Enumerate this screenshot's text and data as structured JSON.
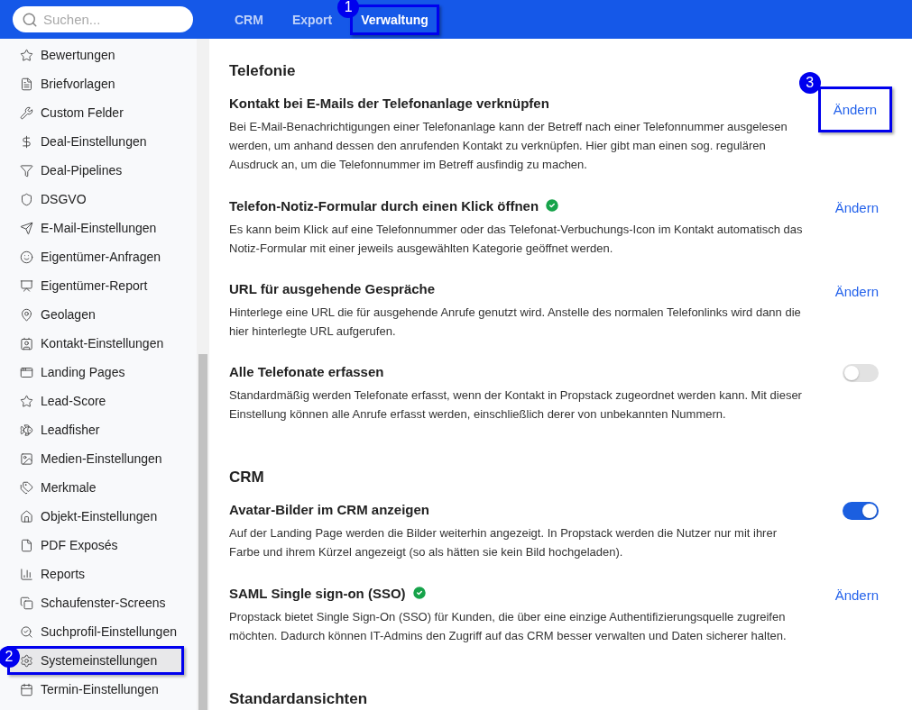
{
  "search": {
    "placeholder": "Suchen..."
  },
  "nav_tabs": [
    {
      "label": "CRM",
      "selected": false
    },
    {
      "label": "Export",
      "selected": false
    },
    {
      "label": "Verwaltung",
      "selected": true,
      "annotation": "1"
    }
  ],
  "sidebar": {
    "items": [
      {
        "label": "Bewertungen",
        "selected": false
      },
      {
        "label": "Briefvorlagen",
        "selected": false
      },
      {
        "label": "Custom Felder",
        "selected": false
      },
      {
        "label": "Deal-Einstellungen",
        "selected": false
      },
      {
        "label": "Deal-Pipelines",
        "selected": false
      },
      {
        "label": "DSGVO",
        "selected": false
      },
      {
        "label": "E-Mail-Einstellungen",
        "selected": false
      },
      {
        "label": "Eigentümer-Anfragen",
        "selected": false
      },
      {
        "label": "Eigentümer-Report",
        "selected": false
      },
      {
        "label": "Geolagen",
        "selected": false
      },
      {
        "label": "Kontakt-Einstellungen",
        "selected": false
      },
      {
        "label": "Landing Pages",
        "selected": false
      },
      {
        "label": "Lead-Score",
        "selected": false
      },
      {
        "label": "Leadfisher",
        "selected": false
      },
      {
        "label": "Medien-Einstellungen",
        "selected": false
      },
      {
        "label": "Merkmale",
        "selected": false
      },
      {
        "label": "Objekt-Einstellungen",
        "selected": false
      },
      {
        "label": "PDF Exposés",
        "selected": false
      },
      {
        "label": "Reports",
        "selected": false
      },
      {
        "label": "Schaufenster-Screens",
        "selected": false
      },
      {
        "label": "Suchprofil-Einstellungen",
        "selected": false
      },
      {
        "label": "Systemeinstellungen",
        "selected": true,
        "annotation": "2"
      },
      {
        "label": "Termin-Einstellungen",
        "selected": false
      }
    ]
  },
  "sections": [
    {
      "title": "Telefonie",
      "settings": [
        {
          "kind": "action",
          "title": "Kontakt bei E-Mails der Telefonanlage verknüpfen",
          "verified": false,
          "description": "Bei E-Mail-Benachrichtigungen einer Telefonanlage kann der Betreff nach einer Telefonnummer ausgelesen werden, um anhand dessen den anrufenden Kontakt zu verknüpfen. Hier gibt man einen sog. regulären Ausdruck an, um die Telefonnummer im Betreff ausfindig zu machen.",
          "action": "Ändern",
          "annotation": "3"
        },
        {
          "kind": "action",
          "title": "Telefon-Notiz-Formular durch einen Klick öffnen",
          "verified": true,
          "description": "Es kann beim Klick auf eine Telefonnummer oder das Telefonat-Verbuchungs-Icon im Kontakt automatisch das Notiz-Formular mit einer jeweils ausgewählten Kategorie geöffnet werden.",
          "action": "Ändern"
        },
        {
          "kind": "action",
          "title": "URL für ausgehende Gespräche",
          "verified": false,
          "description": "Hinterlege eine URL die für ausgehende Anrufe genutzt wird. Anstelle des normalen Telefonlinks wird dann die hier hinterlegte URL aufgerufen.",
          "action": "Ändern"
        },
        {
          "kind": "toggle",
          "title": "Alle Telefonate erfassen",
          "verified": false,
          "description": "Standardmäßig werden Telefonate erfasst, wenn der Kontakt in Propstack zugeordnet werden kann. Mit dieser Einstellung können alle Anrufe erfasst werden, einschließlich derer von unbekannten Nummern.",
          "on": false
        }
      ]
    },
    {
      "title": "CRM",
      "settings": [
        {
          "kind": "toggle",
          "title": "Avatar-Bilder im CRM anzeigen",
          "verified": false,
          "description": "Auf der Landing Page werden die Bilder weiterhin angezeigt. In Propstack werden die Nutzer nur mit ihrer Farbe und ihrem Kürzel angezeigt (so als hätten sie kein Bild hochgeladen).",
          "on": true
        },
        {
          "kind": "action",
          "title": "SAML Single sign-on (SSO)",
          "verified": true,
          "description": "Propstack bietet Single Sign-On (SSO) für Kunden, die über eine einzige Authentifizierungsquelle zugreifen möchten. Dadurch können IT-Admins den Zugriff auf das CRM besser verwalten und Daten sicherer halten.",
          "action": "Ändern"
        }
      ]
    },
    {
      "title": "Standardansichten"
    }
  ]
}
